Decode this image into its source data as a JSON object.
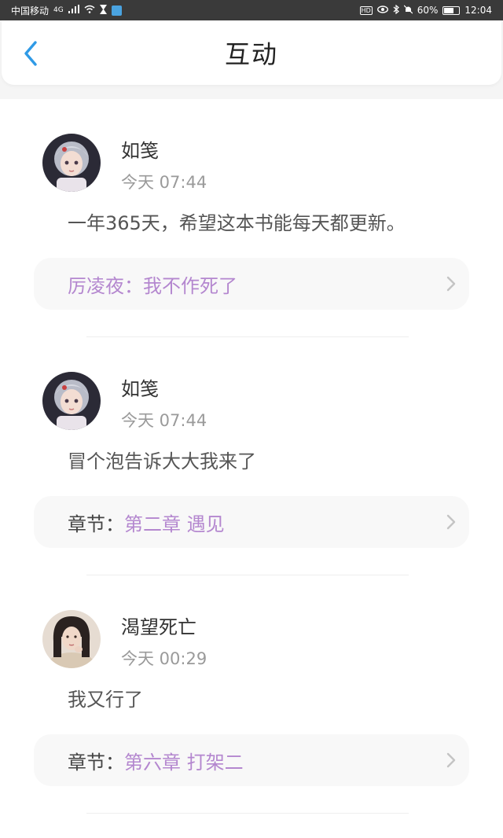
{
  "status_bar": {
    "carrier": "中国移动",
    "network": "4G",
    "hd_badge": "HD",
    "battery": "60%",
    "time": "12:04"
  },
  "header": {
    "title": "互动",
    "back_icon": "chevron-left-icon"
  },
  "comments": [
    {
      "username": "如笺",
      "time": "今天 07:44",
      "text": "一年365天，希望这本书能每天都更新。",
      "ref_prefix": "",
      "ref_link": "厉凌夜：我不作死了"
    },
    {
      "username": "如笺",
      "time": "今天 07:44",
      "text": "冒个泡告诉大大我来了",
      "ref_prefix": "章节：",
      "ref_link": "第二章 遇见"
    },
    {
      "username": "渴望死亡",
      "time": "今天 00:29",
      "text": "我又行了",
      "ref_prefix": "章节：",
      "ref_link": "第六章 打架二"
    }
  ],
  "colors": {
    "accent_blue": "#2f9ae6",
    "link_purple": "#b487cf"
  }
}
